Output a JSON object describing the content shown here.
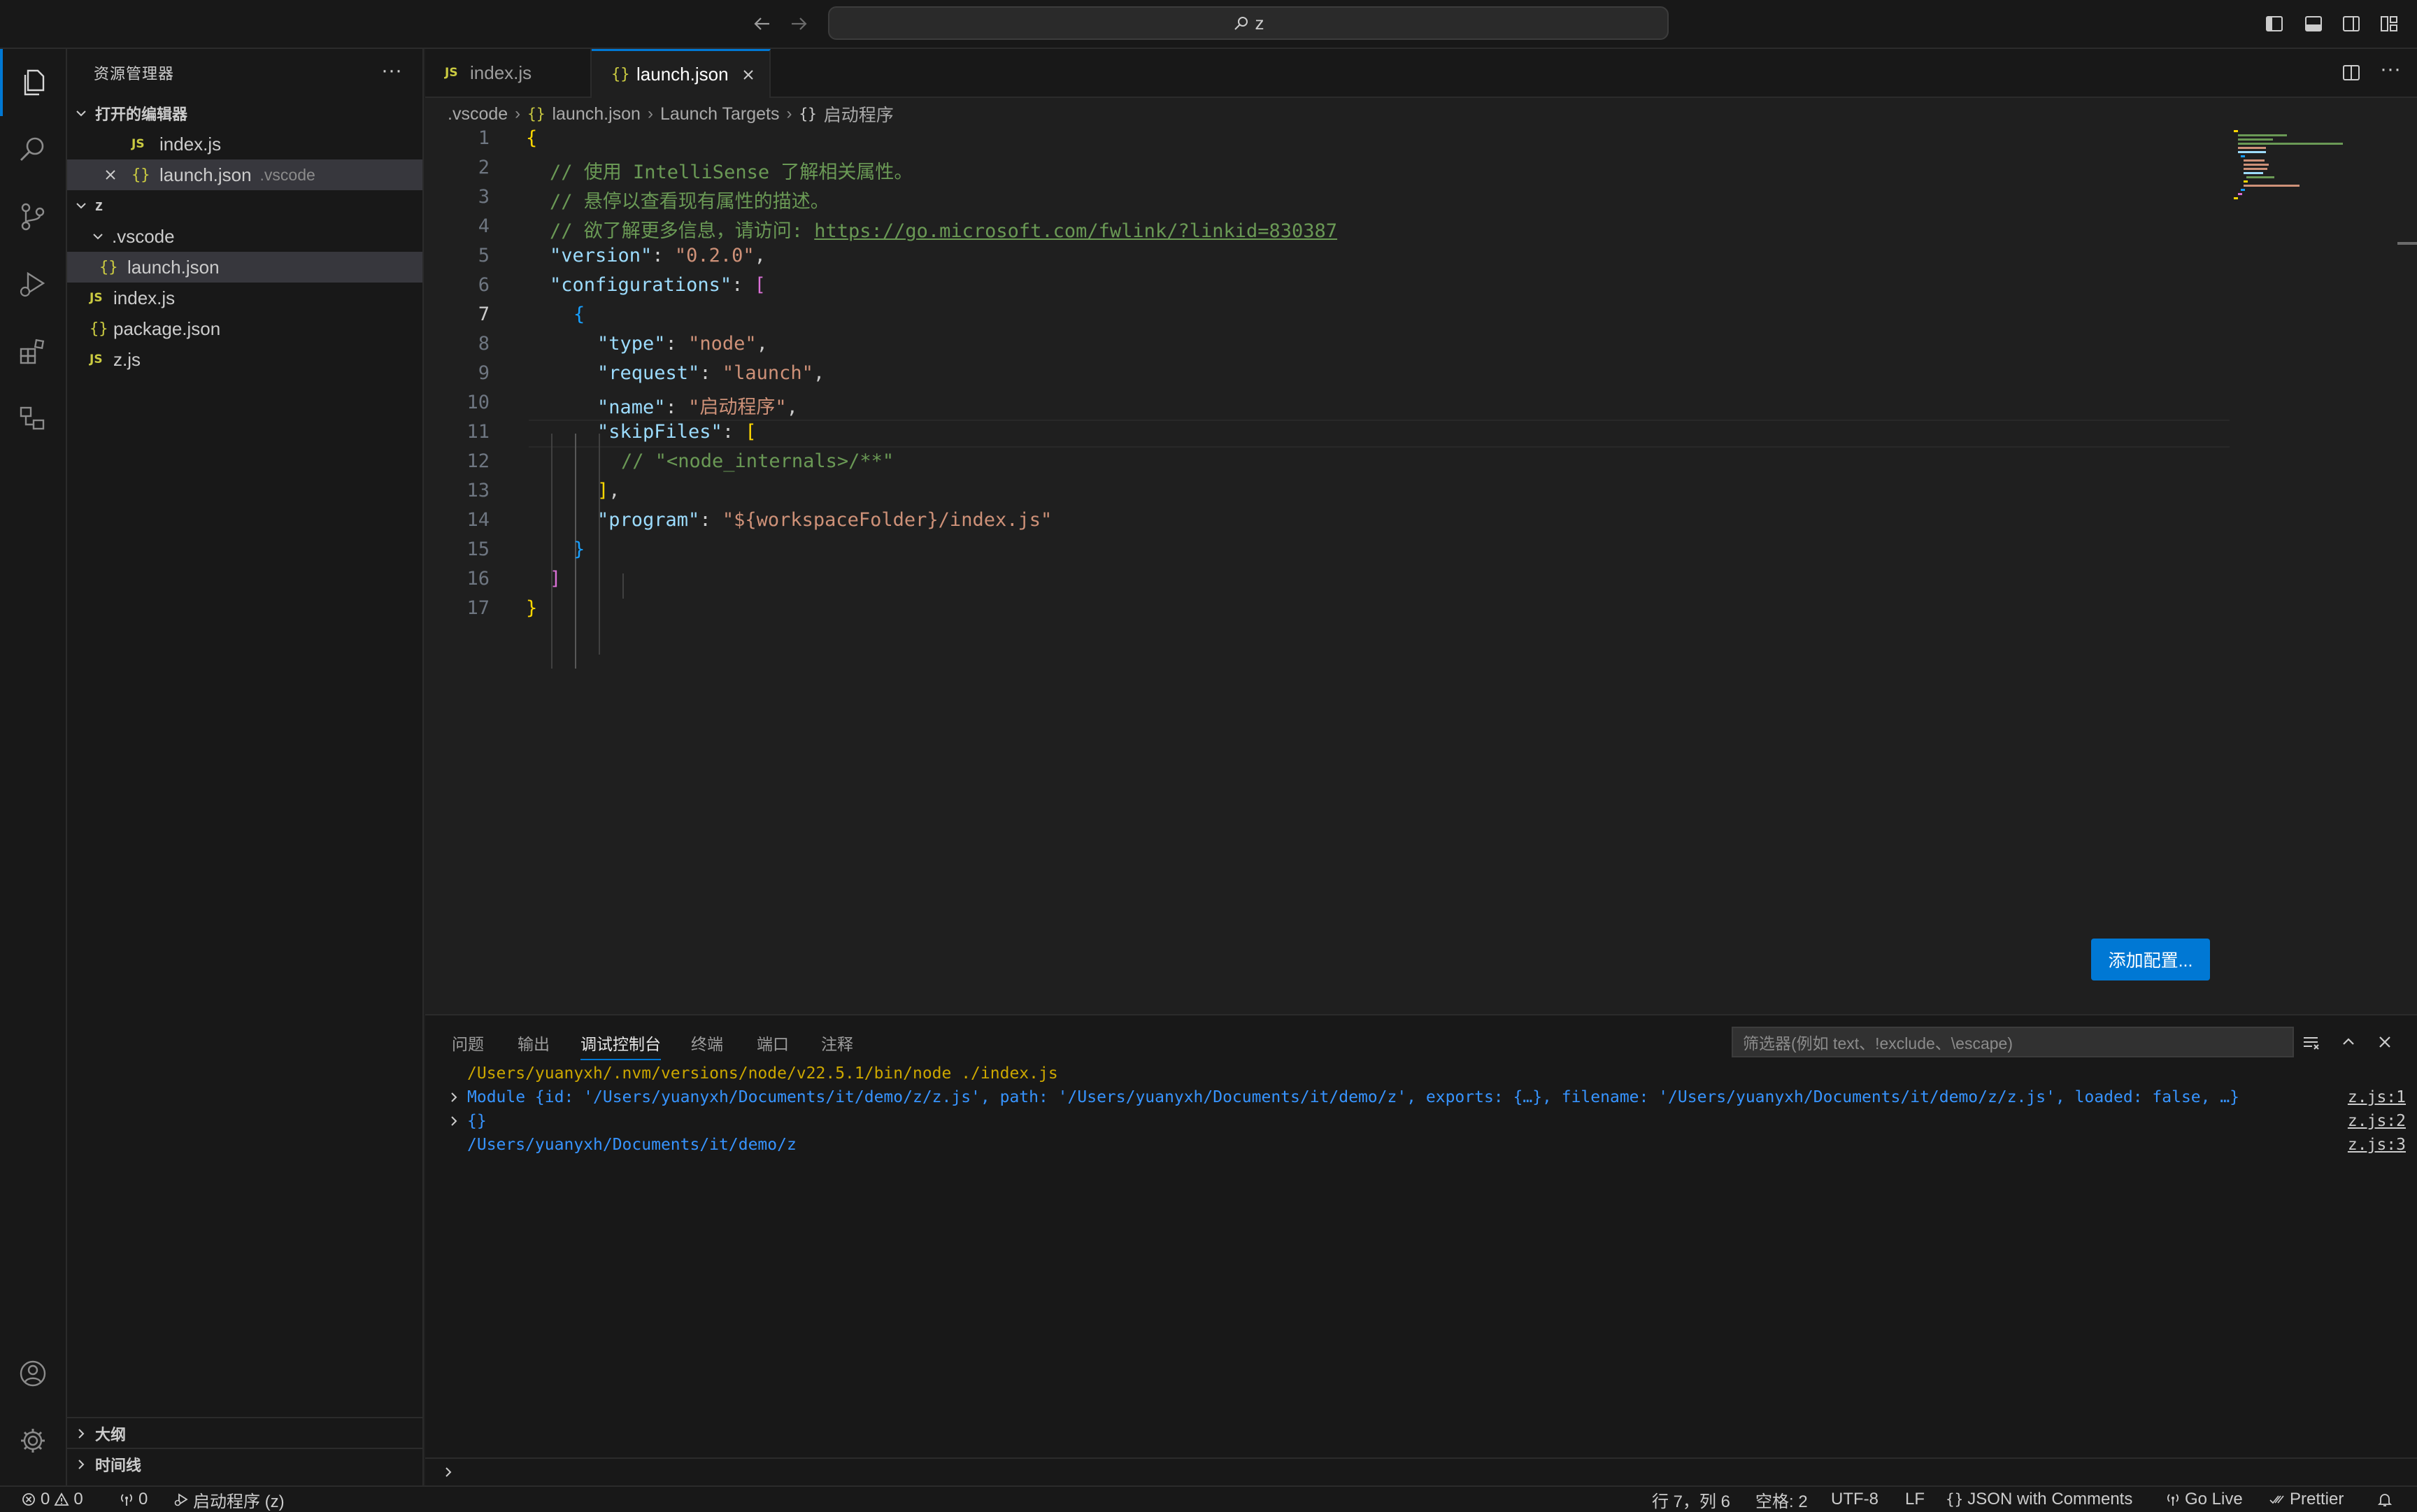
{
  "titlebar": {
    "search_text": "z"
  },
  "sidebar": {
    "title": "资源管理器",
    "more": "···",
    "open_editors_label": "打开的编辑器",
    "open_editors": [
      {
        "badge": "JS",
        "label": "index.js",
        "hint": ""
      },
      {
        "badge": "{}",
        "label": "launch.json",
        "hint": ".vscode"
      }
    ],
    "folder_label": "z",
    "tree": [
      {
        "badge": "",
        "label": ".vscode"
      },
      {
        "badge": "{}",
        "label": "launch.json"
      },
      {
        "badge": "JS",
        "label": "index.js"
      },
      {
        "badge": "{}",
        "label": "package.json"
      },
      {
        "badge": "JS",
        "label": "z.js"
      }
    ],
    "outline_label": "大纲",
    "timeline_label": "时间线"
  },
  "tabs": [
    {
      "badge": "JS",
      "label": "index.js"
    },
    {
      "badge": "{}",
      "label": "launch.json"
    }
  ],
  "breadcrumb": {
    "items": [
      ".vscode",
      "launch.json",
      "Launch Targets",
      "启动程序"
    ],
    "badge": "{}"
  },
  "editor": {
    "line_numbers": [
      "1",
      "2",
      "3",
      "4",
      "5",
      "6",
      "7",
      "8",
      "9",
      "10",
      "11",
      "12",
      "13",
      "14",
      "15",
      "16",
      "17"
    ],
    "comment1": "// 使用 IntelliSense 了解相关属性。",
    "comment2": "// 悬停以查看现有属性的描述。",
    "comment3_prefix": "// 欲了解更多信息，请访问: ",
    "link": "https://go.microsoft.com/fwlink/?linkid=830387",
    "version_key": "\"version\"",
    "version_val": "\"0.2.0\"",
    "configurations_key": "\"configurations\"",
    "type_key": "\"type\"",
    "type_val": "\"node\"",
    "request_key": "\"request\"",
    "request_val": "\"launch\"",
    "name_key": "\"name\"",
    "name_val": "\"启动程序\"",
    "skipfiles_key": "\"skipFiles\"",
    "skipfiles_comment": "// \"<node_internals>/**\"",
    "program_key": "\"program\"",
    "program_val": "\"${workspaceFolder}/index.js\"",
    "add_config_label": "添加配置..."
  },
  "panel": {
    "tabs": [
      "问题",
      "输出",
      "调试控制台",
      "终端",
      "端口",
      "注释"
    ],
    "active_tab": "调试控制台",
    "filter_placeholder": "筛选器(例如 text、!exclude、\\escape)",
    "console": [
      {
        "text": "/Users/yuanyxh/.nvm/versions/node/v22.5.1/bin/node ./index.js",
        "source": ""
      },
      {
        "text": "Module {id: '/Users/yuanyxh/Documents/it/demo/z/z.js', path: '/Users/yuanyxh/Documents/it/demo/z', exports: {…}, filename: '/Users/yuanyxh/Documents/it/demo/z/z.js', loaded: false, …}",
        "source": "z.js:1"
      },
      {
        "text": "{}",
        "source": "z.js:2"
      },
      {
        "text": "/Users/yuanyxh/Documents/it/demo/z",
        "source": "z.js:3"
      }
    ]
  },
  "statusbar": {
    "errors": "0",
    "warnings": "0",
    "ports": "0",
    "debug_target": "启动程序 (z)",
    "cursor": "行 7，列 6",
    "spaces": "空格: 2",
    "encoding": "UTF-8",
    "eol": "LF",
    "lang_badge": "{}",
    "language": "JSON with Comments",
    "golive": "Go Live",
    "prettier": "Prettier"
  },
  "colors": {
    "accent": "#0078d4",
    "comment": "#6a9955",
    "key": "#9cdcfe",
    "string": "#ce9178",
    "bracket1": "#ffd700",
    "bracket2": "#da70d6",
    "bracket3": "#179fff"
  }
}
